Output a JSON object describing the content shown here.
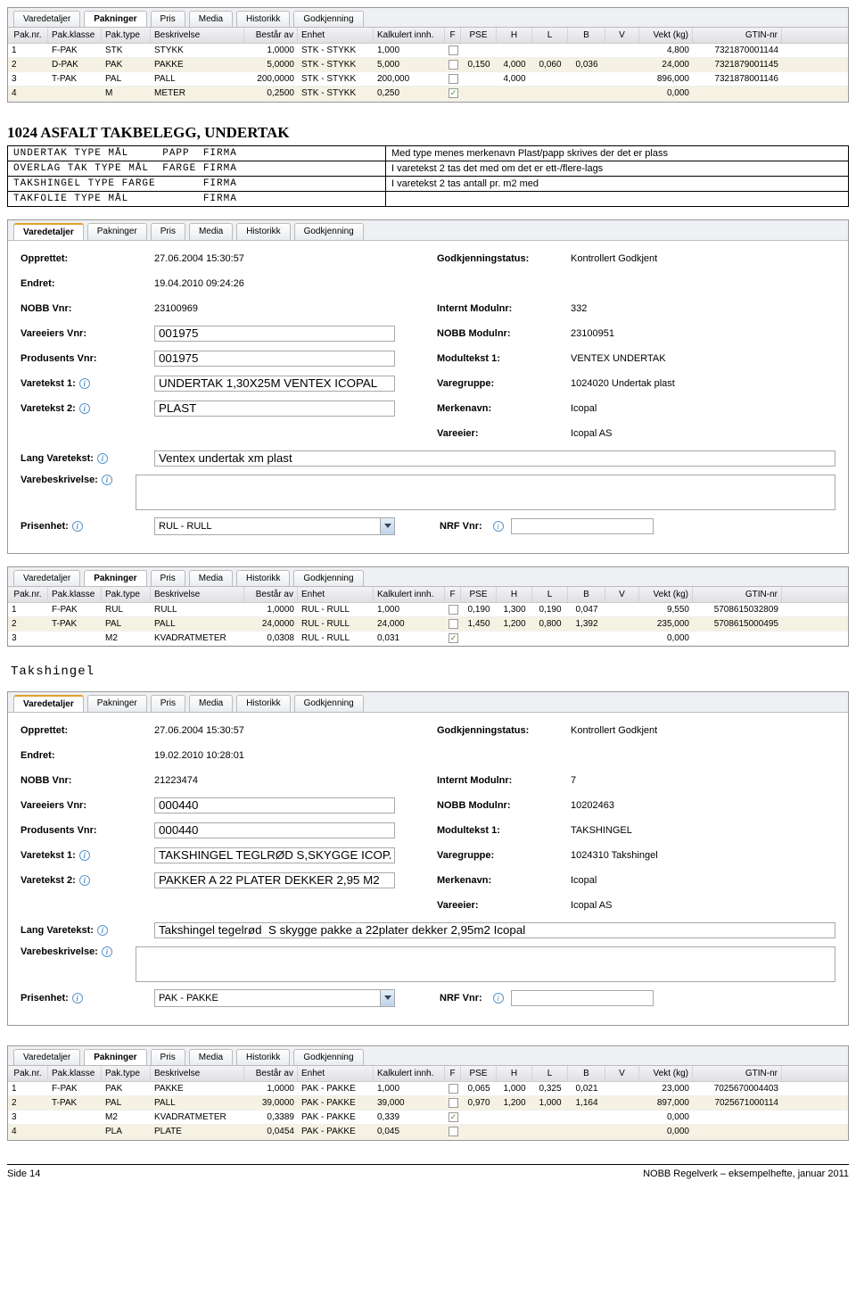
{
  "tabs": [
    "Varedetaljer",
    "Pakninger",
    "Pris",
    "Media",
    "Historikk",
    "Godkjenning"
  ],
  "gridHeaders": [
    "Pak.nr.",
    "Pak.klasse",
    "Pak.type",
    "Beskrivelse",
    "Består av",
    "Enhet",
    "Kalkulert innh.",
    "F",
    "PSE",
    "H",
    "L",
    "B",
    "V",
    "Vekt (kg)",
    "GTIN-nr"
  ],
  "grid1": [
    {
      "nr": "1",
      "kl": "F-PAK",
      "typ": "STK",
      "besk": "STYKK",
      "av": "1,0000",
      "enh": "STK - STYKK",
      "kalk": "1,000",
      "f": false,
      "pse": "",
      "h": "",
      "l": "",
      "b": "",
      "v": "",
      "vekt": "4,800",
      "gtin": "7321870001144"
    },
    {
      "nr": "2",
      "kl": "D-PAK",
      "typ": "PAK",
      "besk": "PAKKE",
      "av": "5,0000",
      "enh": "STK - STYKK",
      "kalk": "5,000",
      "f": false,
      "pse": "0,150",
      "h": "4,000",
      "l": "0,060",
      "b": "0,036",
      "v": "",
      "vekt": "24,000",
      "gtin": "7321879001145"
    },
    {
      "nr": "3",
      "kl": "T-PAK",
      "typ": "PAL",
      "besk": "PALL",
      "av": "200,0000",
      "enh": "STK - STYKK",
      "kalk": "200,000",
      "f": false,
      "pse": "",
      "h": "4,000",
      "l": "",
      "b": "",
      "v": "",
      "vekt": "896,000",
      "gtin": "7321878001146"
    },
    {
      "nr": "4",
      "kl": "",
      "typ": "M",
      "besk": "METER",
      "av": "0,2500",
      "enh": "STK - STYKK",
      "kalk": "0,250",
      "f": true,
      "pse": "",
      "h": "",
      "l": "",
      "b": "",
      "v": "",
      "vekt": "0,000",
      "gtin": ""
    }
  ],
  "sectionTitle": "1024 ASFALT TAKBELEGG, UNDERTAK",
  "rules": [
    {
      "code": "UNDERTAK TYPE MÅL     PAPP  FIRMA",
      "desc": "Med type menes merkenavn Plast/papp skrives der det er plass"
    },
    {
      "code": "OVERLAG TAK TYPE MÅL  FARGE FIRMA",
      "desc": "I varetekst 2 tas det med om det er ett-/flere-lags"
    },
    {
      "code": "TAKSHINGEL TYPE FARGE       FIRMA",
      "desc": "I varetekst 2 tas antall pr. m2 med"
    },
    {
      "code": "TAKFOLIE TYPE MÅL           FIRMA",
      "desc": ""
    }
  ],
  "form1": {
    "opprettet": "27.06.2004 15:30:57",
    "endret": "19.04.2010 09:24:26",
    "nobbvnr": "23100969",
    "vareeiersvnr": "001975",
    "prodvnr": "001975",
    "vt1": "UNDERTAK 1,30X25M VENTEX ICOPAL",
    "vt2": "PLAST",
    "langvt": "Ventex undertak xm plast",
    "varebeskr": "",
    "prisenhet": "RUL - RULL",
    "godkjstatus": "Kontrollert Godkjent",
    "internt": "332",
    "nobbmod": "23100951",
    "modultekst": "VENTEX UNDERTAK",
    "varegruppe": "1024020 Undertak plast",
    "merkenavn": "Icopal",
    "vareeier": "Icopal AS",
    "nrfvnr": ""
  },
  "grid2": [
    {
      "nr": "1",
      "kl": "F-PAK",
      "typ": "RUL",
      "besk": "RULL",
      "av": "1,0000",
      "enh": "RUL - RULL",
      "kalk": "1,000",
      "f": false,
      "pse": "0,190",
      "h": "1,300",
      "l": "0,190",
      "b": "0,047",
      "v": "",
      "vekt": "9,550",
      "gtin": "5708615032809"
    },
    {
      "nr": "2",
      "kl": "T-PAK",
      "typ": "PAL",
      "besk": "PALL",
      "av": "24,0000",
      "enh": "RUL - RULL",
      "kalk": "24,000",
      "f": false,
      "pse": "1,450",
      "h": "1,200",
      "l": "0,800",
      "b": "1,392",
      "v": "",
      "vekt": "235,000",
      "gtin": "5708615000495"
    },
    {
      "nr": "3",
      "kl": "",
      "typ": "M2",
      "besk": "KVADRATMETER",
      "av": "0,0308",
      "enh": "RUL - RULL",
      "kalk": "0,031",
      "f": true,
      "pse": "",
      "h": "",
      "l": "",
      "b": "",
      "v": "",
      "vekt": "0,000",
      "gtin": ""
    }
  ],
  "sub2": "Takshingel",
  "form2": {
    "opprettet": "27.06.2004 15:30:57",
    "endret": "19.02.2010 10:28:01",
    "nobbvnr": "21223474",
    "vareeiersvnr": "000440",
    "prodvnr": "000440",
    "vt1": "TAKSHINGEL TEGLRØD S,SKYGGE ICOPAL",
    "vt2": "PAKKER A 22 PLATER DEKKER 2,95 M2",
    "langvt": "Takshingel tegelrød  S skygge pakke a 22plater dekker 2,95m2 Icopal",
    "varebeskr": "",
    "prisenhet": "PAK - PAKKE",
    "godkjstatus": "Kontrollert Godkjent",
    "internt": "7",
    "nobbmod": "10202463",
    "modultekst": "TAKSHINGEL",
    "varegruppe": "1024310 Takshingel",
    "merkenavn": "Icopal",
    "vareeier": "Icopal AS",
    "nrfvnr": ""
  },
  "grid3": [
    {
      "nr": "1",
      "kl": "F-PAK",
      "typ": "PAK",
      "besk": "PAKKE",
      "av": "1,0000",
      "enh": "PAK - PAKKE",
      "kalk": "1,000",
      "f": false,
      "pse": "0,065",
      "h": "1,000",
      "l": "0,325",
      "b": "0,021",
      "v": "",
      "vekt": "23,000",
      "gtin": "7025670004403"
    },
    {
      "nr": "2",
      "kl": "T-PAK",
      "typ": "PAL",
      "besk": "PALL",
      "av": "39,0000",
      "enh": "PAK - PAKKE",
      "kalk": "39,000",
      "f": false,
      "pse": "0,970",
      "h": "1,200",
      "l": "1,000",
      "b": "1,164",
      "v": "",
      "vekt": "897,000",
      "gtin": "7025671000114"
    },
    {
      "nr": "3",
      "kl": "",
      "typ": "M2",
      "besk": "KVADRATMETER",
      "av": "0,3389",
      "enh": "PAK - PAKKE",
      "kalk": "0,339",
      "f": true,
      "pse": "",
      "h": "",
      "l": "",
      "b": "",
      "v": "",
      "vekt": "0,000",
      "gtin": ""
    },
    {
      "nr": "4",
      "kl": "",
      "typ": "PLA",
      "besk": "PLATE",
      "av": "0,0454",
      "enh": "PAK - PAKKE",
      "kalk": "0,045",
      "f": false,
      "pse": "",
      "h": "",
      "l": "",
      "b": "",
      "v": "",
      "vekt": "0,000",
      "gtin": ""
    }
  ],
  "labels": {
    "opprettet": "Opprettet:",
    "endret": "Endret:",
    "nobbvnr": "NOBB Vnr:",
    "vareeiersvnr": "Vareeiers Vnr:",
    "prodvnr": "Produsents Vnr:",
    "vt1": "Varetekst 1:",
    "vt2": "Varetekst 2:",
    "langvt": "Lang Varetekst:",
    "varebeskr": "Varebeskrivelse:",
    "prisenhet": "Prisenhet:",
    "godkjstatus": "Godkjenningstatus:",
    "internt": "Internt Modulnr:",
    "nobbmod": "NOBB Modulnr:",
    "modultekst": "Modultekst 1:",
    "varegruppe": "Varegruppe:",
    "merkenavn": "Merkenavn:",
    "vareeier": "Vareeier:",
    "nrfvnr": "NRF Vnr:"
  },
  "footer": {
    "left": "Side 14",
    "right": "NOBB Regelverk – eksempelhefte, januar 2011"
  }
}
